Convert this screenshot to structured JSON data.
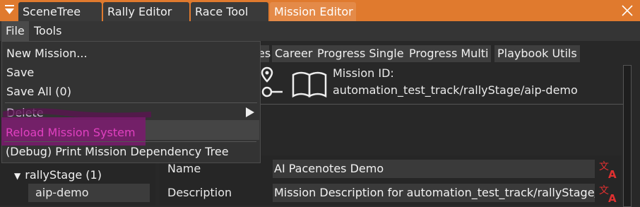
{
  "tabs": [
    "SceneTree",
    "Rally Editor",
    "Race Tool",
    "Mission Editor"
  ],
  "menubar": {
    "file": "File",
    "tools": "Tools"
  },
  "file_menu": {
    "new_mission": "New Mission...",
    "save": "Save",
    "save_all": "Save All (0)",
    "delete": "Delete",
    "reload": "Reload Mission System",
    "debug_print": "(Debug) Print Mission Dependency Tree"
  },
  "subtabs": [
    "es",
    "Career",
    "Progress Single",
    "Progress Multi",
    "Playbook Utils"
  ],
  "mission": {
    "id_label": "Mission ID:",
    "id_value": "automation_test_track/rallyStage/aip-demo"
  },
  "tree": {
    "folder": "rallyStage (1)",
    "item": "aip-demo"
  },
  "form": {
    "name_label": "Name",
    "name_value": "AI Pacenotes Demo",
    "description_label": "Description",
    "description_value": "Mission Description for automation_test_track/rallyStage/aip-demo"
  },
  "colors": {
    "accent": "#e07a2e",
    "highlight": "#7b1a6e",
    "reload_text": "#e040c0",
    "translate_icon": "#e03030"
  },
  "icons": [
    "collapse-triangle-icon",
    "close-icon",
    "map-pin-route-icon",
    "book-icon",
    "translate-icon",
    "submenu-arrow-icon",
    "tree-expand-icon"
  ]
}
